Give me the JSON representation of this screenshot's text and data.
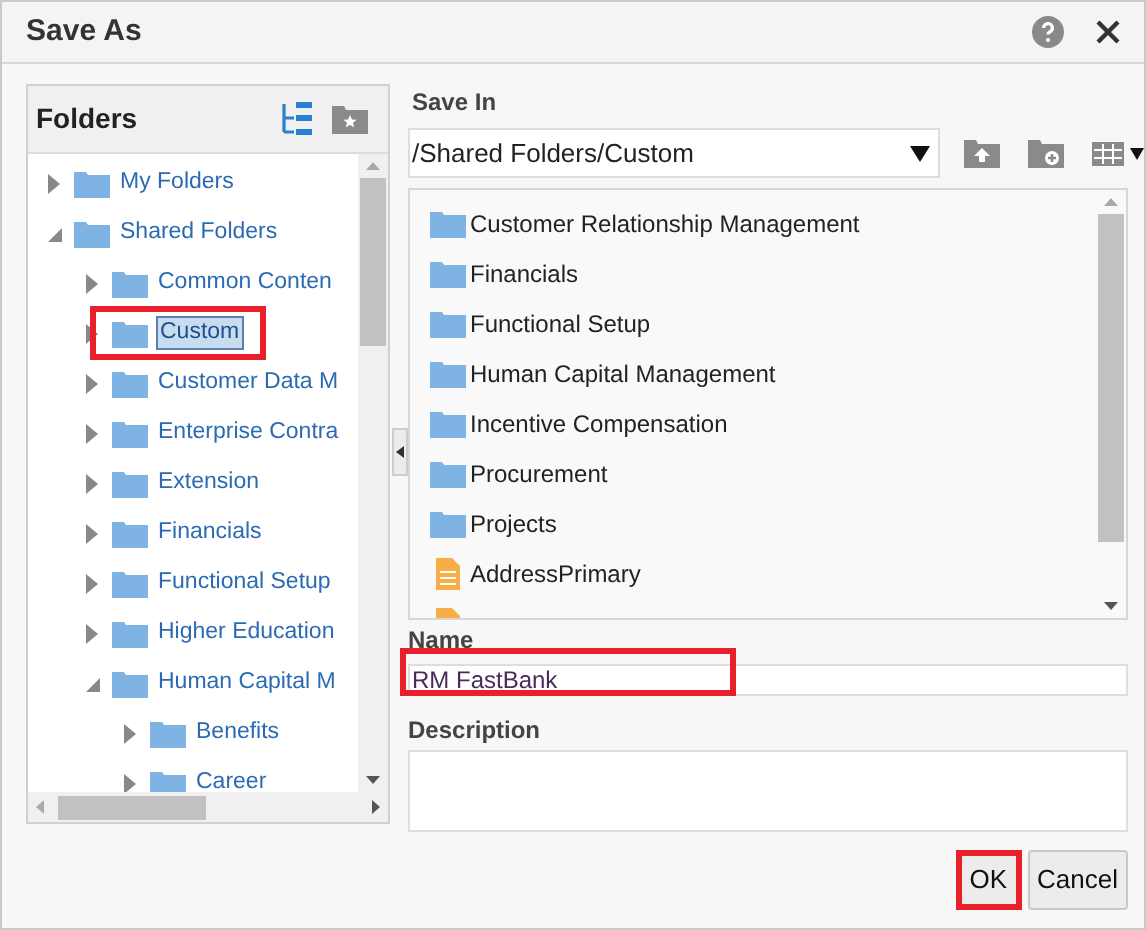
{
  "window": {
    "title": "Save As"
  },
  "folders_panel": {
    "title": "Folders",
    "tree": [
      {
        "label": "My Folders",
        "expanded": false,
        "selected": false,
        "highlighted": false
      },
      {
        "label": "Shared Folders",
        "expanded": true,
        "selected": false,
        "highlighted": false,
        "children": [
          {
            "label": "Common Conten",
            "expanded": false,
            "selected": false,
            "highlighted": false
          },
          {
            "label": "Custom",
            "expanded": false,
            "selected": true,
            "highlighted": true
          },
          {
            "label": "Customer Data M",
            "expanded": false,
            "selected": false,
            "highlighted": false
          },
          {
            "label": "Enterprise Contra",
            "expanded": false,
            "selected": false,
            "highlighted": false
          },
          {
            "label": "Extension",
            "expanded": false,
            "selected": false,
            "highlighted": false
          },
          {
            "label": "Financials",
            "expanded": false,
            "selected": false,
            "highlighted": false
          },
          {
            "label": "Functional Setup",
            "expanded": false,
            "selected": false,
            "highlighted": false
          },
          {
            "label": "Higher Education",
            "expanded": false,
            "selected": false,
            "highlighted": false
          },
          {
            "label": "Human Capital M",
            "expanded": true,
            "selected": false,
            "highlighted": false,
            "children": [
              {
                "label": "Benefits",
                "expanded": false,
                "selected": false,
                "highlighted": false
              },
              {
                "label": "Career",
                "expanded": false,
                "selected": false,
                "highlighted": false
              }
            ]
          }
        ]
      }
    ]
  },
  "save_in": {
    "label": "Save In",
    "path": "/Shared Folders/Custom",
    "items": [
      {
        "kind": "folder",
        "name": "Customer Relationship Management"
      },
      {
        "kind": "folder",
        "name": "Financials"
      },
      {
        "kind": "folder",
        "name": "Functional Setup"
      },
      {
        "kind": "folder",
        "name": "Human Capital Management"
      },
      {
        "kind": "folder",
        "name": "Incentive Compensation"
      },
      {
        "kind": "folder",
        "name": "Procurement"
      },
      {
        "kind": "folder",
        "name": "Projects"
      },
      {
        "kind": "file",
        "name": "AddressPrimary"
      },
      {
        "kind": "file"
      }
    ]
  },
  "name": {
    "label": "Name",
    "value": "RM FastBank",
    "highlighted": true
  },
  "description": {
    "label": "Description"
  },
  "buttons": [
    {
      "label": "OK",
      "highlighted": true
    },
    {
      "label": "Cancel",
      "highlighted": false
    }
  ]
}
